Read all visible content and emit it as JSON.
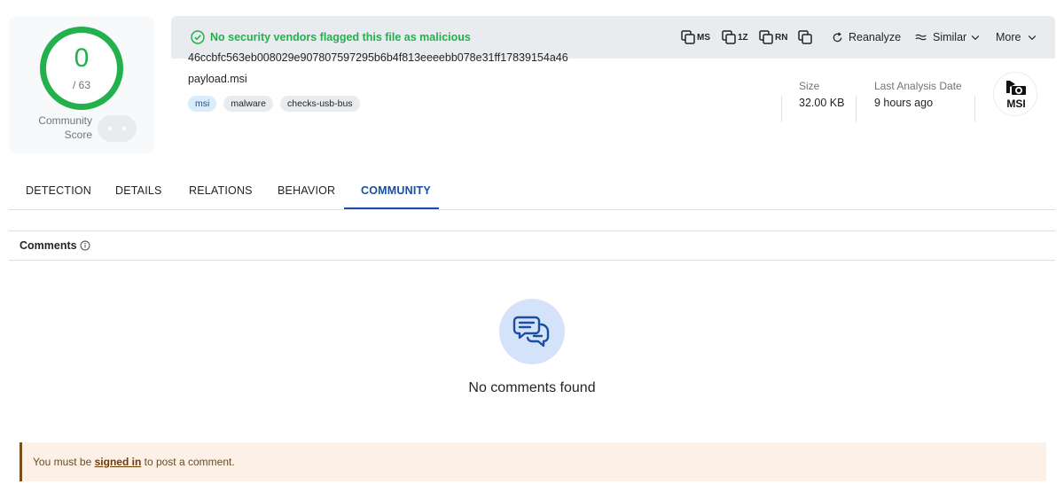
{
  "score": {
    "detections": "0",
    "total": "/ 63",
    "community_label": "Community Score",
    "ring_color": "#22b14c"
  },
  "banner": {
    "message": "No security vendors flagged this file as malicious",
    "color": "#22b14c"
  },
  "toolbar": {
    "tools": [
      {
        "label": "MS",
        "icon": "copy-icon"
      },
      {
        "label": "1Z",
        "icon": "copy-icon"
      },
      {
        "label": "RN",
        "icon": "copy-icon"
      },
      {
        "label": "",
        "icon": "copy-icon"
      }
    ],
    "reanalyze_label": "Reanalyze",
    "similar_label": "Similar",
    "more_label": "More"
  },
  "file": {
    "hash": "46ccbfc563eb008029e907807597295b6b4f813eeeebb078e31ff17839154a46",
    "name": "payload.msi",
    "tags": [
      "msi",
      "malware",
      "checks-usb-bus"
    ],
    "size_label": "Size",
    "size_value": "32.00 KB",
    "date_label": "Last Analysis Date",
    "date_value": "9 hours ago",
    "type_badge": "MSI"
  },
  "tabs": [
    {
      "label": "DETECTION"
    },
    {
      "label": "DETAILS"
    },
    {
      "label": "RELATIONS"
    },
    {
      "label": "BEHAVIOR"
    },
    {
      "label": "COMMUNITY",
      "active": true
    }
  ],
  "comments": {
    "title": "Comments",
    "empty_message": "No comments found",
    "notice_prefix": "You must be ",
    "notice_link": "signed in",
    "notice_suffix": " to post a comment."
  },
  "colors": {
    "accent": "#1a4fa0",
    "success": "#22b14c",
    "notice_bg": "#fdf0e6"
  }
}
